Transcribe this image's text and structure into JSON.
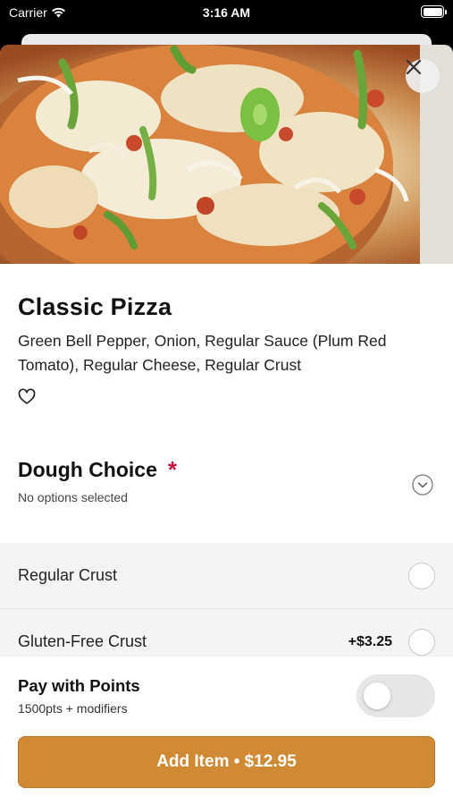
{
  "status_bar": {
    "carrier": "Carrier",
    "time": "3:16 AM"
  },
  "item": {
    "title": "Classic Pizza",
    "description": "Green Bell Pepper, Onion, Regular Sauce (Plum Red Tomato), Regular Cheese, Regular Crust"
  },
  "dough_group": {
    "title": "Dough Choice",
    "required_mark": "*",
    "subtitle": "No options selected",
    "options": [
      {
        "label": "Regular Crust",
        "price": ""
      },
      {
        "label": "Gluten-Free Crust",
        "price": "+$3.25"
      }
    ]
  },
  "points": {
    "title": "Pay with Points",
    "subtitle": "1500pts + modifiers",
    "enabled": false
  },
  "add_button": {
    "label": "Add Item • $12.95"
  },
  "colors": {
    "accent": "#d18a34",
    "required": "#c8103e"
  },
  "icons": [
    "wifi-icon",
    "battery-icon",
    "close-icon",
    "heart-icon",
    "chevron-down-icon"
  ]
}
